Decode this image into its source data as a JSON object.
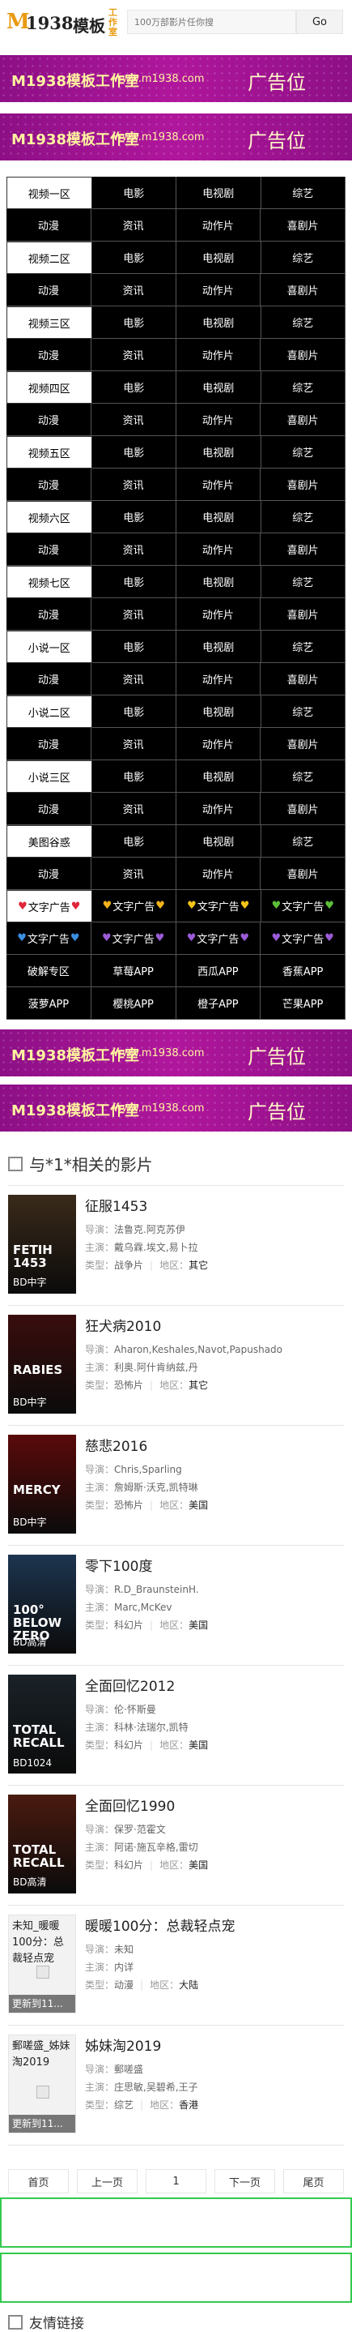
{
  "header": {
    "logo_m": "M",
    "logo_num": "1938",
    "logo_mb": "模板",
    "logo_gzs": "工作室",
    "search_placeholder": "100万部影片任你搜",
    "search_button": "Go"
  },
  "banner": {
    "brand": "M1938模板工作室",
    "url": "www.m1938.com",
    "ad_label": "广告位"
  },
  "nav": {
    "rows": [
      [
        "视频一区",
        "电影",
        "电视剧",
        "综艺"
      ],
      [
        "动漫",
        "资讯",
        "动作片",
        "喜剧片"
      ],
      [
        "视频二区",
        "电影",
        "电视剧",
        "综艺"
      ],
      [
        "动漫",
        "资讯",
        "动作片",
        "喜剧片"
      ],
      [
        "视频三区",
        "电影",
        "电视剧",
        "综艺"
      ],
      [
        "动漫",
        "资讯",
        "动作片",
        "喜剧片"
      ],
      [
        "视频四区",
        "电影",
        "电视剧",
        "综艺"
      ],
      [
        "动漫",
        "资讯",
        "动作片",
        "喜剧片"
      ],
      [
        "视频五区",
        "电影",
        "电视剧",
        "综艺"
      ],
      [
        "动漫",
        "资讯",
        "动作片",
        "喜剧片"
      ],
      [
        "视频六区",
        "电影",
        "电视剧",
        "综艺"
      ],
      [
        "动漫",
        "资讯",
        "动作片",
        "喜剧片"
      ],
      [
        "视频七区",
        "电影",
        "电视剧",
        "综艺"
      ],
      [
        "动漫",
        "资讯",
        "动作片",
        "喜剧片"
      ],
      [
        "小说一区",
        "电影",
        "电视剧",
        "综艺"
      ],
      [
        "动漫",
        "资讯",
        "动作片",
        "喜剧片"
      ],
      [
        "小说二区",
        "电影",
        "电视剧",
        "综艺"
      ],
      [
        "动漫",
        "资讯",
        "动作片",
        "喜剧片"
      ],
      [
        "小说三区",
        "电影",
        "电视剧",
        "综艺"
      ],
      [
        "动漫",
        "资讯",
        "动作片",
        "喜剧片"
      ],
      [
        "美图谷惑",
        "电影",
        "电视剧",
        "综艺"
      ],
      [
        "动漫",
        "资讯",
        "动作片",
        "喜剧片"
      ]
    ],
    "text_ad_label": "文字广告",
    "heart_colors_row1": [
      "#e0243a",
      "#f2b21b",
      "#f2c417",
      "#5cbf3a"
    ],
    "heart_colors_row2": [
      "#3b8fe0",
      "#9b5bd6",
      "#9b5bd6",
      "#9b5bd6"
    ],
    "apps": [
      "破解专区",
      "草莓APP",
      "西瓜APP",
      "香蕉APP",
      "菠萝APP",
      "樱桃APP",
      "橙子APP",
      "芒果APP"
    ]
  },
  "section": {
    "title": "与*1*相关的影片"
  },
  "labels": {
    "director": "导演：",
    "star": "主演：",
    "type": "类型：",
    "area": "地区："
  },
  "movies": [
    {
      "name": "征服1453",
      "poster_title": "FETIH 1453",
      "badge": "BD中字",
      "director": "法鲁克.阿克苏伊",
      "star": "戴乌霖.埃文,易卜拉",
      "type": "战争片",
      "area": "其它",
      "color": "#3a2a1a"
    },
    {
      "name": "狂犬病2010",
      "poster_title": "RABIES",
      "badge": "BD中字",
      "director": "Aharon,Keshales,Navot,Papushado",
      "star": "利奥.阿什肯纳兹,丹",
      "type": "恐怖片",
      "area": "其它",
      "color": "#3a0d0d"
    },
    {
      "name": "慈悲2016",
      "poster_title": "MERCY",
      "badge": "BD中字",
      "director": "Chris,Sparling",
      "star": "詹姆斯·沃克,凯特琳",
      "type": "恐怖片",
      "area": "美国",
      "color": "#5a0a0a"
    },
    {
      "name": "零下100度",
      "poster_title": "100° BELOW ZERO",
      "badge": "BD高清",
      "director": "R.D_BraunsteinH.",
      "star": "Marc,McKev",
      "type": "科幻片",
      "area": "美国",
      "color": "#1d3550"
    },
    {
      "name": "全面回忆2012",
      "poster_title": "TOTAL RECALL",
      "badge": "BD1024",
      "director": "伦·怀斯曼",
      "star": "科林·法瑞尔,凯特",
      "type": "科幻片",
      "area": "美国",
      "color": "#1a2228"
    },
    {
      "name": "全面回忆1990",
      "poster_title": "TOTAL RECALL",
      "badge": "BD高清",
      "director": "保罗·范霍文",
      "star": "阿诺·施瓦辛格,雷切",
      "type": "科幻片",
      "area": "美国",
      "color": "#4a1a10"
    },
    {
      "name": "暖暖100分：总裁轻点宠",
      "poster_label": "未知_暖暖100分：总裁轻点宠",
      "badge": "更新到11...",
      "director": "未知",
      "star": "内详",
      "type": "动漫",
      "area": "大陆"
    },
    {
      "name": "姊妹淘2019",
      "poster_label": "郵嗟盛_姊妹淘2019",
      "badge": "更新到11...",
      "director": "郵嗟盛",
      "star": "庄思敏,吴碧希,王子",
      "type": "综艺",
      "area": "香港"
    }
  ],
  "pager": {
    "first": "首页",
    "prev": "上一页",
    "current": "1",
    "next": "下一页",
    "last": "尾页"
  },
  "footer": {
    "title": "友情链接"
  }
}
